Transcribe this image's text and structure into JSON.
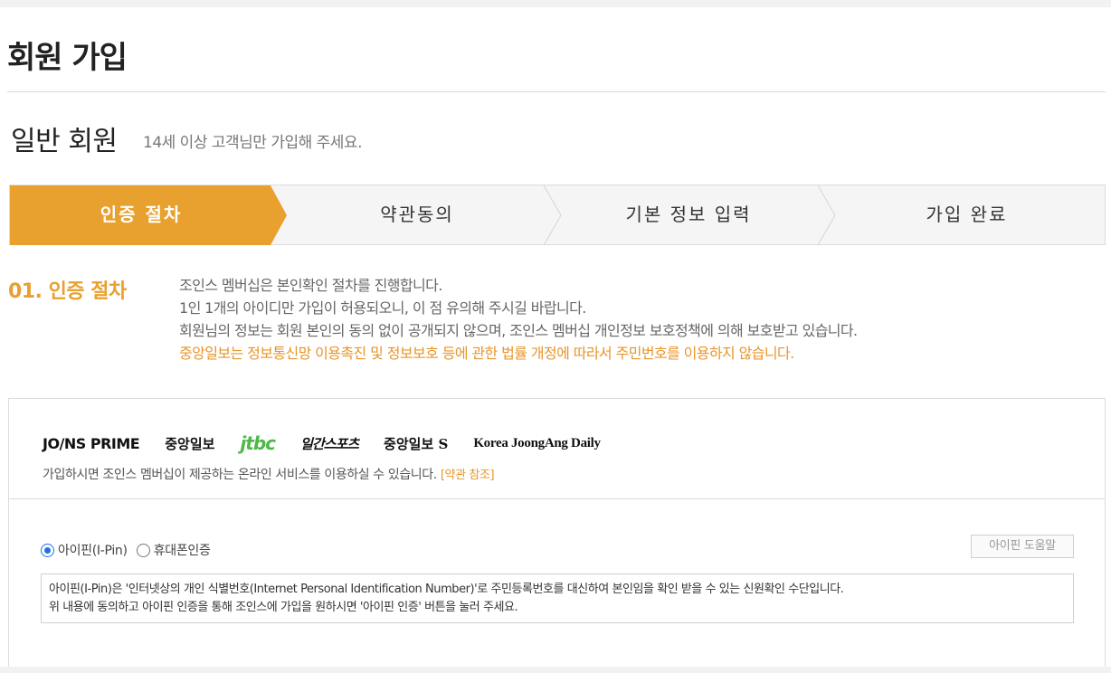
{
  "page": {
    "title": "회원 가입"
  },
  "member": {
    "type": "일반 회원",
    "description": "14세 이상 고객님만 가입해 주세요."
  },
  "steps": [
    {
      "label": "인증 절차",
      "active": true
    },
    {
      "label": "약관동의",
      "active": false
    },
    {
      "label": "기본 정보 입력",
      "active": false
    },
    {
      "label": "가입 완료",
      "active": false
    }
  ],
  "section": {
    "title": "01. 인증 절차",
    "lines": [
      "조인스 멤버십은 본인확인 절차를 진행합니다.",
      "1인 1개의 아이디만 가입이 허용되오니, 이 점 유의해 주시길 바랍니다.",
      "회원님의 정보는 회원 본인의 동의 없이 공개되지 않으며, 조인스 멤버십 개인정보 보호정책에 의해 보호받고 있습니다."
    ],
    "warning": "중앙일보는 정보통신망 이용촉진 및 정보보호 등에 관한 법률 개정에 따라서 주민번호를 이용하지 않습니다."
  },
  "services": {
    "logos": [
      "JO/NS PRIME",
      "중앙일보",
      "jtbc",
      "일간스포츠",
      "중앙일보 S",
      "Korea JoongAng Daily"
    ],
    "text": "가입하시면 조인스 멤버십이 제공하는 온라인 서비스를 이용하실 수 있습니다.",
    "terms_link": "[약관 참조]"
  },
  "auth": {
    "options": [
      {
        "label": "아이핀(I-Pin)",
        "selected": true
      },
      {
        "label": "휴대폰인증",
        "selected": false
      }
    ],
    "help_button": "아이핀 도움말",
    "description": [
      "아이핀(I-Pin)은 '인터넷상의 개인 식별번호(Internet Personal Identification Number)'로 주민등록번호를 대신하여 본인임을 확인 받을 수 있는 신원확인 수단입니다.",
      "위 내용에 동의하고 아이핀 인증을 통해 조인스에 가입을 원하시면 '아이핀 인증' 버튼을 눌러 주세요."
    ]
  },
  "colors": {
    "accent": "#e8a02e",
    "warning_text": "#e8952a",
    "jtbc_green": "#4fb848",
    "radio_blue": "#1a73e8"
  }
}
